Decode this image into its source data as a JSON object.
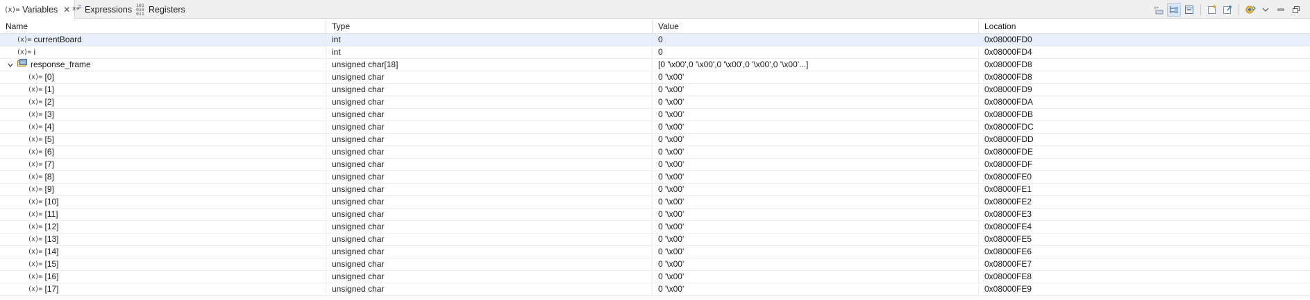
{
  "tabs": [
    {
      "label": "Variables",
      "icon": "variables-icon",
      "active": true
    },
    {
      "label": "Expressions",
      "icon": "expressions-icon",
      "active": false
    },
    {
      "label": "Registers",
      "icon": "registers-icon",
      "active": false
    }
  ],
  "var_glyph": "(x)=",
  "columns": {
    "name": "Name",
    "type": "Type",
    "value": "Value",
    "location": "Location"
  },
  "toolbar": [
    "show-type-names-icon",
    "show-logical-structure-icon",
    "collapse-all-icon",
    "add-global-variables-icon",
    "remove-global-variables-icon",
    "restore-default-icon",
    "view-menu-icon",
    "minimize-icon",
    "maximize-icon"
  ],
  "rows": [
    {
      "name": "currentBoard",
      "type": "int",
      "value": "0",
      "location": "0x08000FD0",
      "selected": true,
      "icon": "variable-icon"
    },
    {
      "name": "i",
      "type": "int",
      "value": "0",
      "location": "0x08000FD4",
      "icon": "variable-icon"
    },
    {
      "name": "response_frame",
      "type": "unsigned char[18]",
      "value": "[0 '\\x00',0 '\\x00',0 '\\x00',0 '\\x00',0 '\\x00'...]",
      "location": "0x08000FD8",
      "expanded": true,
      "icon": "array-variable-icon"
    },
    {
      "name": "[0]",
      "type": "unsigned char",
      "value": "0 '\\x00'",
      "location": "0x08000FD8",
      "child": true,
      "icon": "variable-icon"
    },
    {
      "name": "[1]",
      "type": "unsigned char",
      "value": "0 '\\x00'",
      "location": "0x08000FD9",
      "child": true,
      "icon": "variable-icon"
    },
    {
      "name": "[2]",
      "type": "unsigned char",
      "value": "0 '\\x00'",
      "location": "0x08000FDA",
      "child": true,
      "icon": "variable-icon"
    },
    {
      "name": "[3]",
      "type": "unsigned char",
      "value": "0 '\\x00'",
      "location": "0x08000FDB",
      "child": true,
      "icon": "variable-icon"
    },
    {
      "name": "[4]",
      "type": "unsigned char",
      "value": "0 '\\x00'",
      "location": "0x08000FDC",
      "child": true,
      "icon": "variable-icon"
    },
    {
      "name": "[5]",
      "type": "unsigned char",
      "value": "0 '\\x00'",
      "location": "0x08000FDD",
      "child": true,
      "icon": "variable-icon"
    },
    {
      "name": "[6]",
      "type": "unsigned char",
      "value": "0 '\\x00'",
      "location": "0x08000FDE",
      "child": true,
      "icon": "variable-icon"
    },
    {
      "name": "[7]",
      "type": "unsigned char",
      "value": "0 '\\x00'",
      "location": "0x08000FDF",
      "child": true,
      "icon": "variable-icon"
    },
    {
      "name": "[8]",
      "type": "unsigned char",
      "value": "0 '\\x00'",
      "location": "0x08000FE0",
      "child": true,
      "icon": "variable-icon"
    },
    {
      "name": "[9]",
      "type": "unsigned char",
      "value": "0 '\\x00'",
      "location": "0x08000FE1",
      "child": true,
      "icon": "variable-icon"
    },
    {
      "name": "[10]",
      "type": "unsigned char",
      "value": "0 '\\x00'",
      "location": "0x08000FE2",
      "child": true,
      "icon": "variable-icon"
    },
    {
      "name": "[11]",
      "type": "unsigned char",
      "value": "0 '\\x00'",
      "location": "0x08000FE3",
      "child": true,
      "icon": "variable-icon"
    },
    {
      "name": "[12]",
      "type": "unsigned char",
      "value": "0 '\\x00'",
      "location": "0x08000FE4",
      "child": true,
      "icon": "variable-icon"
    },
    {
      "name": "[13]",
      "type": "unsigned char",
      "value": "0 '\\x00'",
      "location": "0x08000FE5",
      "child": true,
      "icon": "variable-icon"
    },
    {
      "name": "[14]",
      "type": "unsigned char",
      "value": "0 '\\x00'",
      "location": "0x08000FE6",
      "child": true,
      "icon": "variable-icon"
    },
    {
      "name": "[15]",
      "type": "unsigned char",
      "value": "0 '\\x00'",
      "location": "0x08000FE7",
      "child": true,
      "icon": "variable-icon"
    },
    {
      "name": "[16]",
      "type": "unsigned char",
      "value": "0 '\\x00'",
      "location": "0x08000FE8",
      "child": true,
      "icon": "variable-icon"
    },
    {
      "name": "[17]",
      "type": "unsigned char",
      "value": "0 '\\x00'",
      "location": "0x08000FE9",
      "child": true,
      "icon": "variable-icon"
    }
  ],
  "colors": {
    "selected_row": "#e8f0fb",
    "grid_line": "#ececec",
    "tab_strip": "#f0f0f0",
    "accent": "#3c7fb1"
  }
}
